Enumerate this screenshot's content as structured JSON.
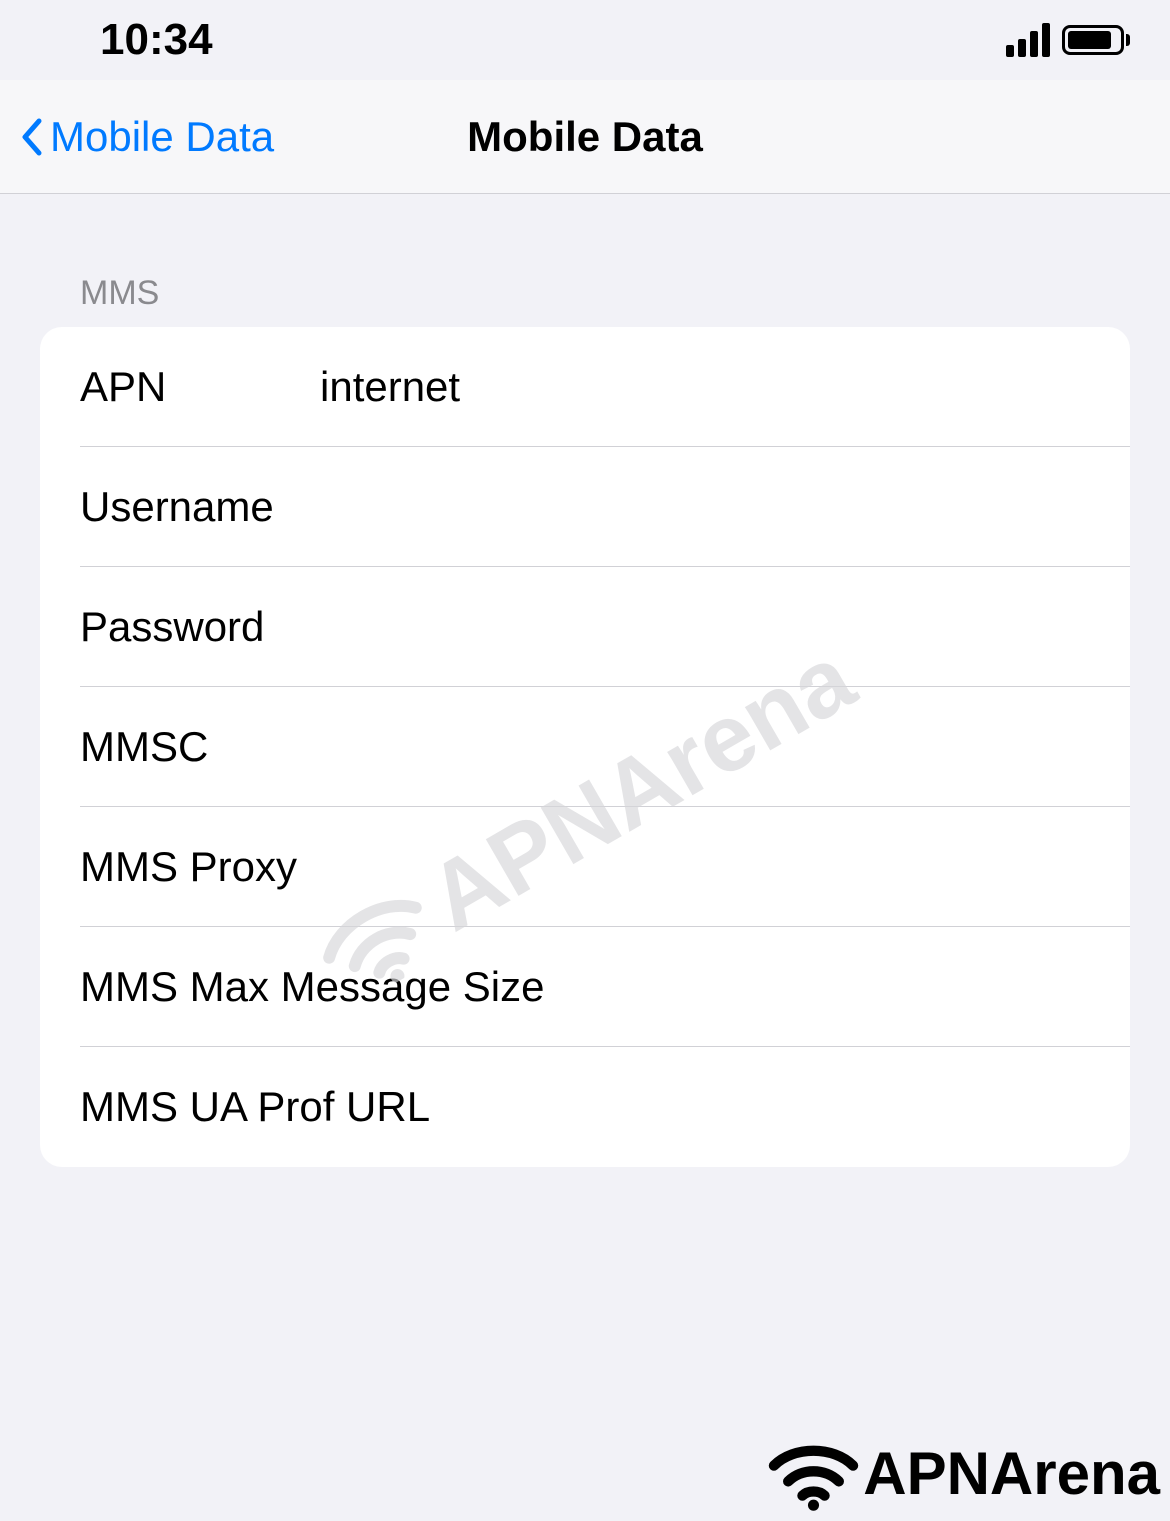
{
  "status_bar": {
    "time": "10:34"
  },
  "nav": {
    "back_label": "Mobile Data",
    "title": "Mobile Data"
  },
  "section": {
    "header": "MMS",
    "rows": [
      {
        "label": "APN",
        "value": "internet"
      },
      {
        "label": "Username",
        "value": ""
      },
      {
        "label": "Password",
        "value": ""
      },
      {
        "label": "MMSC",
        "value": ""
      },
      {
        "label": "MMS Proxy",
        "value": ""
      },
      {
        "label": "MMS Max Message Size",
        "value": ""
      },
      {
        "label": "MMS UA Prof URL",
        "value": ""
      }
    ]
  },
  "watermark": "APNArena",
  "footer": "APNArena"
}
